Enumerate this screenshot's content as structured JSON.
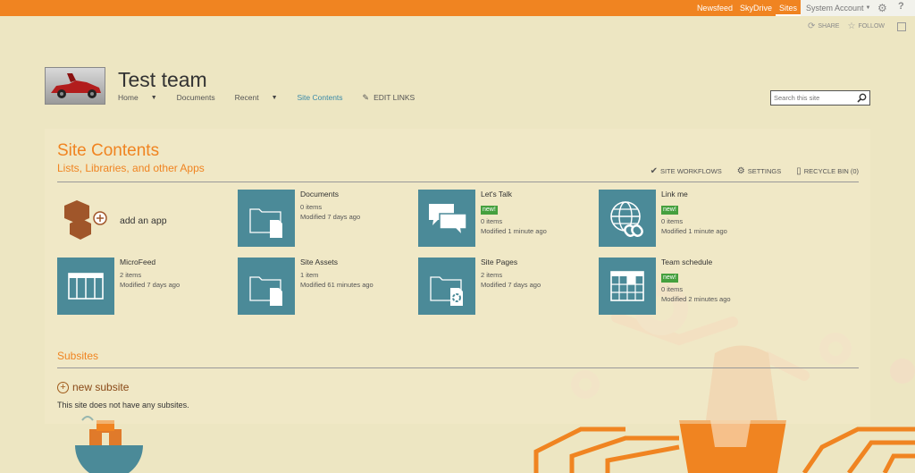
{
  "suite_bar": {
    "links": [
      "Newsfeed",
      "SkyDrive",
      "Sites"
    ],
    "active_link": "Sites",
    "account_name": "System Account",
    "colors": {
      "bar": "#f08421"
    }
  },
  "actions": {
    "share": "SHARE",
    "follow": "FOLLOW"
  },
  "site": {
    "title": "Test team"
  },
  "top_nav": {
    "items": [
      "Home",
      "Documents",
      "Recent",
      "Site Contents"
    ],
    "edit_links": "EDIT LINKS"
  },
  "search": {
    "placeholder": "Search this site"
  },
  "page": {
    "title": "Site Contents",
    "subtitle": "Lists, Libraries, and other Apps"
  },
  "commands": {
    "workflows": "SITE WORKFLOWS",
    "settings": "SETTINGS",
    "recycle_bin": "RECYCLE BIN (0)"
  },
  "add_app": {
    "label": "add an app"
  },
  "apps": [
    {
      "name": "Documents",
      "icon": "folder-document-icon",
      "new_badge": "",
      "items": "0 items",
      "modified": "Modified 7 days ago"
    },
    {
      "name": "Let's Talk",
      "icon": "discussion-icon",
      "new_badge": "new!",
      "items": "0 items",
      "modified": "Modified 1 minute ago"
    },
    {
      "name": "Link me",
      "icon": "globe-link-icon",
      "new_badge": "new!",
      "items": "0 items",
      "modified": "Modified 1 minute ago"
    },
    {
      "name": "MicroFeed",
      "icon": "list-icon",
      "new_badge": "",
      "items": "2 items",
      "modified": "Modified 7 days ago"
    },
    {
      "name": "Site Assets",
      "icon": "folder-document-icon",
      "new_badge": "",
      "items": "1 item",
      "modified": "Modified 61 minutes ago"
    },
    {
      "name": "Site Pages",
      "icon": "folder-pages-icon",
      "new_badge": "",
      "items": "2 items",
      "modified": "Modified 7 days ago"
    },
    {
      "name": "Team schedule",
      "icon": "calendar-icon",
      "new_badge": "new!",
      "items": "0 items",
      "modified": "Modified 2 minutes ago"
    }
  ],
  "subsites": {
    "title": "Subsites",
    "new_label": "new subsite",
    "empty_text": "This site does not have any subsites."
  },
  "colors": {
    "accent": "#f08421",
    "tile": "#4b8a98",
    "badge": "#45a03e"
  }
}
